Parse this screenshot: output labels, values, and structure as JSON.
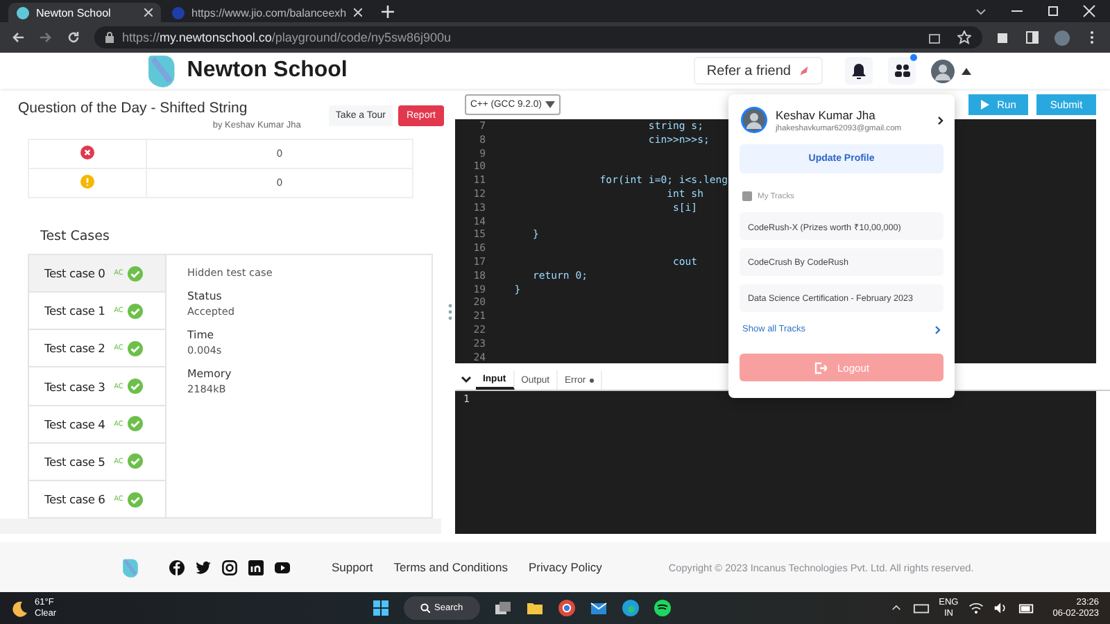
{
  "browser": {
    "tabs": [
      {
        "title": "Newton School",
        "selected": true
      },
      {
        "title": "https://www.jio.com/balanceexh",
        "selected": false
      }
    ],
    "url": {
      "scheme": "https://",
      "host": "my.newtonschool.co",
      "path": "/playground/code/ny5sw86j900u"
    }
  },
  "header": {
    "brand": "Newton School",
    "refer_button": "Refer a friend",
    "team_badge": true
  },
  "problem": {
    "title": "Question of the Day - Shifted String",
    "author": "by Keshav Kumar Jha",
    "tour_button": "Take a Tour",
    "report_button": "Report"
  },
  "summary_rows": [
    {
      "kind": "error",
      "count": "0"
    },
    {
      "kind": "warning",
      "count": "0"
    }
  ],
  "test_cases": {
    "heading": "Test Cases",
    "items": [
      {
        "label": "Test case 0",
        "verdict": "AC",
        "passed": true,
        "selected": true
      },
      {
        "label": "Test case 1",
        "verdict": "AC",
        "passed": true,
        "selected": false
      },
      {
        "label": "Test case 2",
        "verdict": "AC",
        "passed": true,
        "selected": false
      },
      {
        "label": "Test case 3",
        "verdict": "AC",
        "passed": true,
        "selected": false
      },
      {
        "label": "Test case 4",
        "verdict": "AC",
        "passed": true,
        "selected": false
      },
      {
        "label": "Test case 5",
        "verdict": "AC",
        "passed": true,
        "selected": false
      },
      {
        "label": "Test case 6",
        "verdict": "AC",
        "passed": true,
        "selected": false
      }
    ],
    "detail": {
      "note": "Hidden test case",
      "fields": [
        {
          "label": "Status",
          "value": "Accepted"
        },
        {
          "label": "Time",
          "value": "0.004s"
        },
        {
          "label": "Memory",
          "value": "2184kB"
        }
      ]
    }
  },
  "editor": {
    "language": "C++ (GCC 9.2.0)",
    "run_button": "Run",
    "submit_button": "Submit",
    "lines": [
      {
        "number": "7",
        "code": "                        string s;"
      },
      {
        "number": "8",
        "code": "                        cin>>n>>s;"
      },
      {
        "number": "9"
      },
      {
        "number": "10"
      },
      {
        "number": "11",
        "code": "                for(int i=0; i<s.leng"
      },
      {
        "number": "12",
        "code": "                           int sh"
      },
      {
        "number": "13",
        "code": "                            s[i]"
      },
      {
        "number": "14"
      },
      {
        "number": "15",
        "code": "     }"
      },
      {
        "number": "16"
      },
      {
        "number": "17",
        "code": "                            cout"
      },
      {
        "number": "18",
        "code": "     return 0;"
      },
      {
        "number": "19",
        "code": "  }"
      },
      {
        "number": "20"
      },
      {
        "number": "21"
      },
      {
        "number": "22"
      },
      {
        "number": "23"
      },
      {
        "number": "24"
      }
    ]
  },
  "io": {
    "tabs": [
      {
        "label": "Input",
        "selected": true,
        "dot": false
      },
      {
        "label": "Output",
        "selected": false,
        "dot": false
      },
      {
        "label": "Error",
        "selected": false,
        "dot": true
      }
    ],
    "line_numbers": [
      "1"
    ]
  },
  "profile_menu": {
    "name": "Keshav Kumar Jha",
    "email": "jhakeshavkumar62093@gmail.com",
    "update_button": "Update Profile",
    "tracks_heading": "My Tracks",
    "tracks": [
      "CodeRush-X (Prizes worth ₹10,00,000)",
      "CodeCrush By CodeRush",
      "Data Science Certification - February 2023"
    ],
    "show_all": "Show all Tracks",
    "logout": "Logout"
  },
  "footer": {
    "links": [
      "Support",
      "Terms and Conditions",
      "Privacy Policy"
    ],
    "copyright": "Copyright © 2023 Incanus Technologies Pvt. Ltd. All rights reserved."
  },
  "taskbar": {
    "temperature": "61°F",
    "condition": "Clear",
    "search": "Search",
    "language": "ENG",
    "region": "IN",
    "time": "23:26",
    "date": "06-02-2023"
  }
}
